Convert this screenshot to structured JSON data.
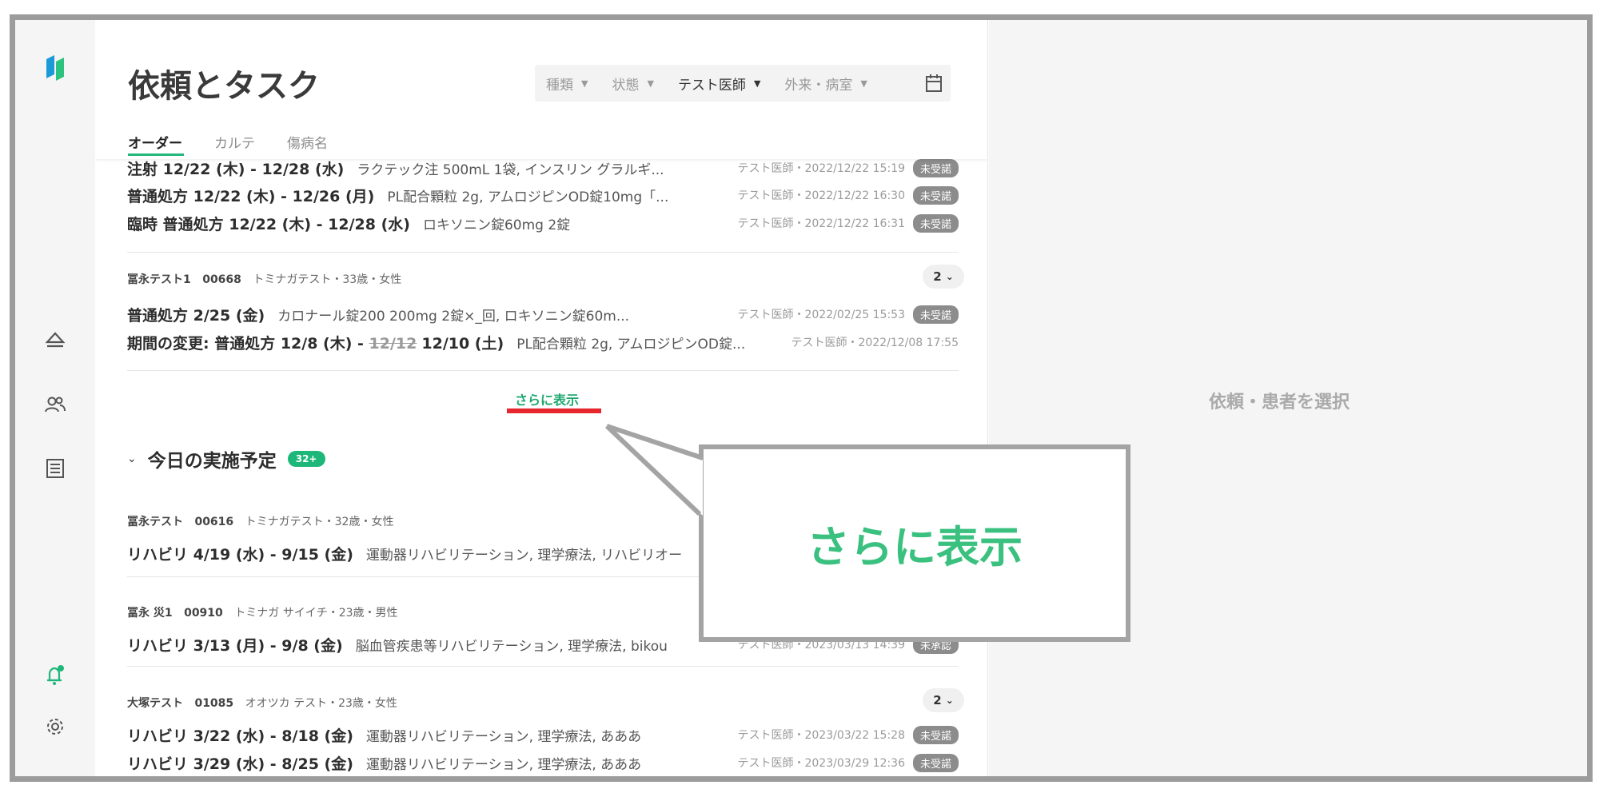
{
  "header": {
    "title": "依頼とタスク",
    "filters": [
      {
        "label": "種類",
        "active": false
      },
      {
        "label": "状態",
        "active": false
      },
      {
        "label": "テスト医師",
        "active": true
      },
      {
        "label": "外来・病室",
        "active": false
      }
    ],
    "tabs": [
      "オーダー",
      "カルテ",
      "傷病名"
    ]
  },
  "orders": {
    "group1_rows": [
      {
        "label": "注射 12/22 (木) - 12/28 (水)",
        "desc": "ラクテック注 500mL 1袋, インスリン グラルギ...",
        "meta": "テスト医師・2022/12/22 15:19",
        "badge": "未受諾"
      },
      {
        "label": "普通処方 12/22 (木) - 12/26 (月)",
        "desc": "PL配合顆粒 2g, アムロジピンOD錠10mg「...",
        "meta": "テスト医師・2022/12/22 16:30",
        "badge": "未受諾"
      },
      {
        "label": "臨時 普通処方 12/22 (木) - 12/28 (水)",
        "desc": "ロキソニン錠60mg 2錠",
        "meta": "テスト医師・2022/12/22 16:31",
        "badge": "未受諾"
      }
    ],
    "patient2": {
      "name": "冨永テスト1",
      "id": "00668",
      "info": "トミナガテスト・33歳・女性",
      "count": "2"
    },
    "group2_rows": [
      {
        "label": "普通処方 2/25 (金)",
        "desc": "カロナール錠200 200mg 2錠×_回, ロキソニン錠60m...",
        "meta": "テスト医師・2022/02/25 15:53",
        "badge": "未受諾"
      },
      {
        "label_prefix": "期間の変更: 普通処方 12/8 (木) -",
        "label_strike": "12/12",
        "label_suffix": "12/10 (土)",
        "desc": "PL配合顆粒 2g, アムロジピンOD錠...",
        "meta": "テスト医師・2022/12/08 17:55"
      }
    ],
    "more_label": "さらに表示"
  },
  "today": {
    "title": "今日の実施予定",
    "badge": "32+",
    "patients": [
      {
        "name": "冨永テスト",
        "id": "00616",
        "info": "トミナガテスト・32歳・女性",
        "rows": [
          {
            "label": "リハビリ 4/19 (水) - 9/15 (金)",
            "desc": "運動器リハビリテーション, 理学療法, リハビリオー"
          }
        ]
      },
      {
        "name": "冨永 災1",
        "id": "00910",
        "info": "トミナガ サイイチ・23歳・男性",
        "rows": [
          {
            "label": "リハビリ 3/13 (月) - 9/8 (金)",
            "desc": "脳血管疾患等リハビリテーション, 理学療法, bikou",
            "meta": "テスト医師・2023/03/13 14:39",
            "badge": "未承認"
          }
        ]
      },
      {
        "name": "大塚テスト",
        "id": "01085",
        "info": "オオツカ テスト・23歳・女性",
        "count": "2",
        "rows": [
          {
            "label": "リハビリ 3/22 (水) - 8/18 (金)",
            "desc": "運動器リハビリテーション, 理学療法, あああ",
            "meta": "テスト医師・2023/03/22 15:28",
            "badge": "未受諾"
          },
          {
            "label": "リハビリ 3/29 (水) - 8/25 (金)",
            "desc": "運動器リハビリテーション, 理学療法, あああ",
            "meta": "テスト医師・2023/03/29 12:36",
            "badge": "未受諾"
          }
        ]
      }
    ]
  },
  "right_panel": {
    "placeholder": "依頼・患者を選択"
  },
  "callout": {
    "text": "さらに表示"
  },
  "colors": {
    "accent": "#23b77e",
    "badge_gray": "#8c8c8c",
    "highlight_red": "#e8262d",
    "panel_bg": "#f5f5f5"
  }
}
